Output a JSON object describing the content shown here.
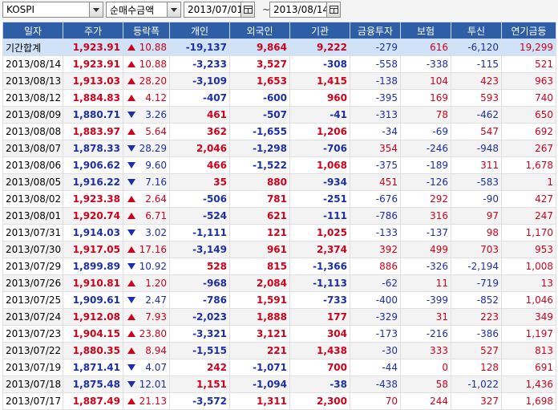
{
  "toolbar": {
    "market": "KOSPI",
    "metric": "순매수금액",
    "start_date": "2013/07/01",
    "separator": "~",
    "end_date": "2013/08/14"
  },
  "columns": [
    "일자",
    "주가",
    "등락폭",
    "개인",
    "외국인",
    "기관",
    "금융투자",
    "보험",
    "투신",
    "연기금등"
  ],
  "colors": {
    "up": "#d0021b",
    "down": "#1c2fa8",
    "header": "#2d5ea6",
    "total_row": "#cfe2f7"
  },
  "rows": [
    {
      "date": "기간합계",
      "price": "1,923.91",
      "dir": "up",
      "change": "10.88",
      "individual": "-19,137",
      "foreign": "9,864",
      "institution": "9,222",
      "fin_invest": "-279",
      "insurance": "616",
      "trust": "-6,120",
      "pension": "19,299"
    },
    {
      "date": "2013/08/14",
      "price": "1,923.91",
      "dir": "up",
      "change": "10.88",
      "individual": "-3,233",
      "foreign": "3,527",
      "institution": "-308",
      "fin_invest": "-558",
      "insurance": "-338",
      "trust": "-115",
      "pension": "521"
    },
    {
      "date": "2013/08/13",
      "price": "1,913.03",
      "dir": "up",
      "change": "28.20",
      "individual": "-3,109",
      "foreign": "1,653",
      "institution": "1,415",
      "fin_invest": "-138",
      "insurance": "104",
      "trust": "423",
      "pension": "963"
    },
    {
      "date": "2013/08/12",
      "price": "1,884.83",
      "dir": "up",
      "change": "4.12",
      "individual": "-407",
      "foreign": "-600",
      "institution": "960",
      "fin_invest": "-395",
      "insurance": "169",
      "trust": "593",
      "pension": "740"
    },
    {
      "date": "2013/08/09",
      "price": "1,880.71",
      "dir": "down",
      "change": "3.26",
      "individual": "461",
      "foreign": "-507",
      "institution": "-41",
      "fin_invest": "-313",
      "insurance": "78",
      "trust": "-462",
      "pension": "650"
    },
    {
      "date": "2013/08/08",
      "price": "1,883.97",
      "dir": "up",
      "change": "5.64",
      "individual": "362",
      "foreign": "-1,655",
      "institution": "1,206",
      "fin_invest": "-34",
      "insurance": "-69",
      "trust": "547",
      "pension": "692"
    },
    {
      "date": "2013/08/07",
      "price": "1,878.33",
      "dir": "down",
      "change": "28.29",
      "individual": "2,046",
      "foreign": "-1,298",
      "institution": "-706",
      "fin_invest": "354",
      "insurance": "-246",
      "trust": "-948",
      "pension": "267"
    },
    {
      "date": "2013/08/06",
      "price": "1,906.62",
      "dir": "down",
      "change": "9.60",
      "individual": "466",
      "foreign": "-1,522",
      "institution": "1,068",
      "fin_invest": "-375",
      "insurance": "-189",
      "trust": "311",
      "pension": "1,678"
    },
    {
      "date": "2013/08/05",
      "price": "1,916.22",
      "dir": "down",
      "change": "7.16",
      "individual": "35",
      "foreign": "880",
      "institution": "-934",
      "fin_invest": "451",
      "insurance": "-126",
      "trust": "-583",
      "pension": "1"
    },
    {
      "date": "2013/08/02",
      "price": "1,923.38",
      "dir": "up",
      "change": "2.64",
      "individual": "-506",
      "foreign": "781",
      "institution": "-251",
      "fin_invest": "-676",
      "insurance": "292",
      "trust": "-90",
      "pension": "427"
    },
    {
      "date": "2013/08/01",
      "price": "1,920.74",
      "dir": "up",
      "change": "6.71",
      "individual": "-524",
      "foreign": "621",
      "institution": "-111",
      "fin_invest": "-786",
      "insurance": "316",
      "trust": "97",
      "pension": "247"
    },
    {
      "date": "2013/07/31",
      "price": "1,914.03",
      "dir": "down",
      "change": "3.02",
      "individual": "-1,111",
      "foreign": "121",
      "institution": "1,025",
      "fin_invest": "-133",
      "insurance": "-137",
      "trust": "98",
      "pension": "1,170"
    },
    {
      "date": "2013/07/30",
      "price": "1,917.05",
      "dir": "up",
      "change": "17.16",
      "individual": "-3,149",
      "foreign": "961",
      "institution": "2,374",
      "fin_invest": "392",
      "insurance": "499",
      "trust": "703",
      "pension": "953"
    },
    {
      "date": "2013/07/29",
      "price": "1,899.89",
      "dir": "down",
      "change": "10.92",
      "individual": "528",
      "foreign": "815",
      "institution": "-1,366",
      "fin_invest": "886",
      "insurance": "-326",
      "trust": "-2,194",
      "pension": "1,008"
    },
    {
      "date": "2013/07/26",
      "price": "1,910.81",
      "dir": "up",
      "change": "1.20",
      "individual": "-968",
      "foreign": "2,084",
      "institution": "-1,113",
      "fin_invest": "-62",
      "insurance": "11",
      "trust": "-719",
      "pension": "13"
    },
    {
      "date": "2013/07/25",
      "price": "1,909.61",
      "dir": "down",
      "change": "2.47",
      "individual": "-786",
      "foreign": "1,591",
      "institution": "-733",
      "fin_invest": "-400",
      "insurance": "-399",
      "trust": "-852",
      "pension": "1,046"
    },
    {
      "date": "2013/07/24",
      "price": "1,912.08",
      "dir": "up",
      "change": "7.93",
      "individual": "-2,023",
      "foreign": "1,888",
      "institution": "177",
      "fin_invest": "-329",
      "insurance": "31",
      "trust": "223",
      "pension": "349"
    },
    {
      "date": "2013/07/23",
      "price": "1,904.15",
      "dir": "up",
      "change": "23.80",
      "individual": "-3,321",
      "foreign": "3,121",
      "institution": "304",
      "fin_invest": "-173",
      "insurance": "-216",
      "trust": "-386",
      "pension": "1,197"
    },
    {
      "date": "2013/07/22",
      "price": "1,880.35",
      "dir": "up",
      "change": "8.94",
      "individual": "-1,515",
      "foreign": "221",
      "institution": "1,438",
      "fin_invest": "-30",
      "insurance": "333",
      "trust": "527",
      "pension": "813"
    },
    {
      "date": "2013/07/19",
      "price": "1,871.41",
      "dir": "down",
      "change": "4.07",
      "individual": "242",
      "foreign": "-1,071",
      "institution": "700",
      "fin_invest": "-44",
      "insurance": "0",
      "trust": "128",
      "pension": "691"
    },
    {
      "date": "2013/07/18",
      "price": "1,875.48",
      "dir": "down",
      "change": "12.01",
      "individual": "1,151",
      "foreign": "-1,094",
      "institution": "-38",
      "fin_invest": "-438",
      "insurance": "58",
      "trust": "-1,022",
      "pension": "1,436"
    },
    {
      "date": "2013/07/17",
      "price": "1,887.49",
      "dir": "up",
      "change": "21.13",
      "individual": "-3,572",
      "foreign": "1,311",
      "institution": "2,300",
      "fin_invest": "70",
      "insurance": "244",
      "trust": "327",
      "pension": "1,698"
    }
  ]
}
